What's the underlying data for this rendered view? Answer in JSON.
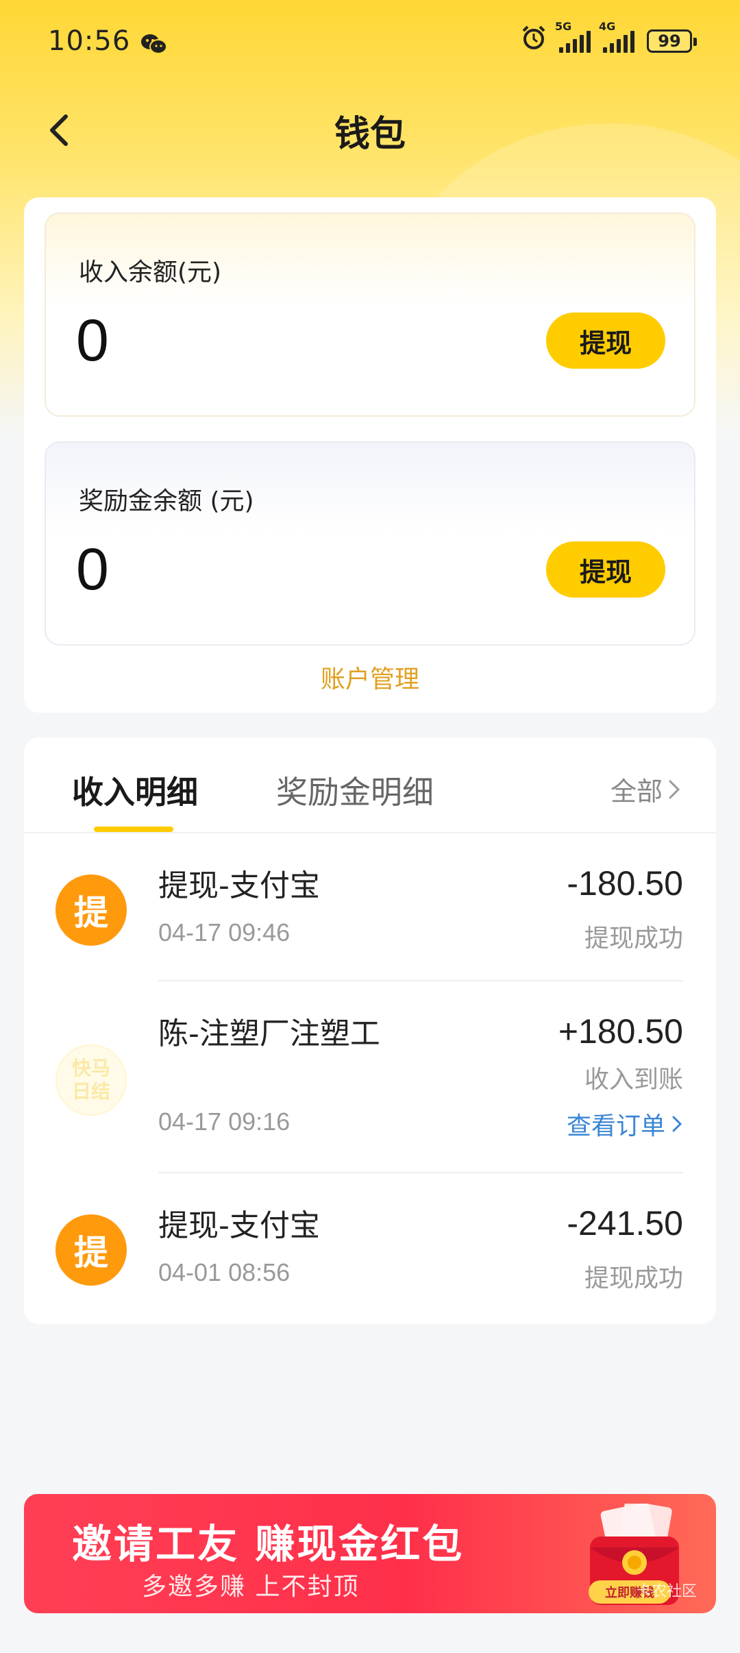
{
  "status_bar": {
    "time": "10:56",
    "network_1": "5G",
    "network_2": "4G",
    "battery": "99"
  },
  "header": {
    "title": "钱包"
  },
  "balances": {
    "income": {
      "label": "收入余额(元)",
      "amount": "0",
      "button": "提现"
    },
    "reward": {
      "label": "奖励金余额 (元)",
      "amount": "0",
      "button": "提现"
    },
    "account_link": "账户管理"
  },
  "details": {
    "tabs": [
      "收入明细",
      "奖励金明细"
    ],
    "all_link": "全部",
    "transactions": [
      {
        "icon_text": "提",
        "title": "提现-支付宝",
        "time": "04-17 09:46",
        "amount": "-180.50",
        "status": "提现成功"
      },
      {
        "icon_text_1": "快马",
        "icon_text_2": "日结",
        "title": "陈-注塑厂注塑工",
        "time": "04-17 09:16",
        "amount": "+180.50",
        "status": "收入到账",
        "link": "查看订单"
      },
      {
        "icon_text": "提",
        "title": "提现-支付宝",
        "time": "04-01 08:56",
        "amount": "-241.50",
        "status": "提现成功"
      }
    ]
  },
  "banner": {
    "title": "邀请工友 赚现金红包",
    "subtitle": "多邀多赚 上不封顶",
    "button": "立即赚钱",
    "watermark": "卡农社区"
  },
  "colors": {
    "brand_yellow": "#ffcc00",
    "accent_orange": "#ff9a0d",
    "link_blue": "#3a86d6",
    "banner_red": "#ff2f4a"
  }
}
